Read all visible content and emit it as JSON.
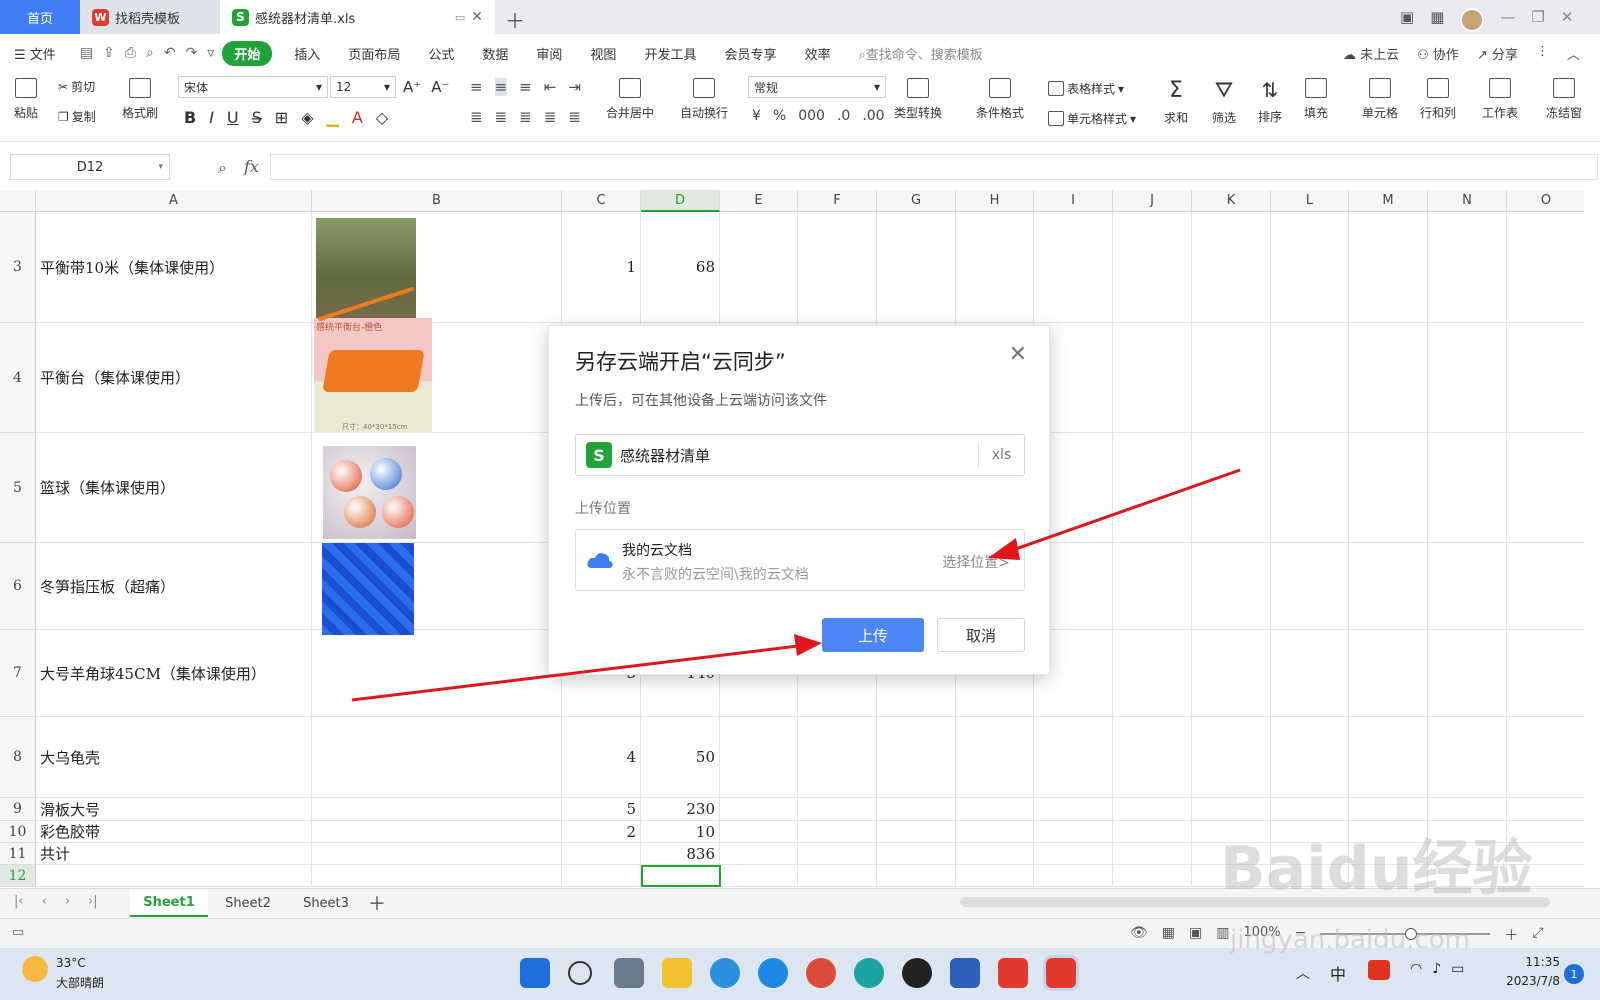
{
  "tabs": {
    "home": "首页",
    "template": "找稻壳模板",
    "file": "感统器材清单.xls"
  },
  "menu": {
    "file": "文件",
    "items": [
      "开始",
      "插入",
      "页面布局",
      "公式",
      "数据",
      "审阅",
      "视图",
      "开发工具",
      "会员专享",
      "效率"
    ],
    "search_placeholder": "查找命令、搜索模板",
    "cloud": "未上云",
    "collab": "协作",
    "share": "分享"
  },
  "ribbon": {
    "paste": "粘贴",
    "cut": "剪切",
    "copy": "复制",
    "format_painter": "格式刷",
    "font": "宋体",
    "size": "12",
    "merge": "合并居中",
    "wrap": "自动换行",
    "number_format": "常规",
    "type_convert": "类型转换",
    "cond_format": "条件格式",
    "table_style": "表格样式",
    "cell_style": "单元格样式",
    "sum": "求和",
    "filter": "筛选",
    "sort": "排序",
    "fill": "填充",
    "cell": "单元格",
    "row_col": "行和列",
    "sheet": "工作表",
    "freeze": "冻结窗"
  },
  "formula_bar": {
    "name_box": "D12",
    "fx": "fx",
    "value": ""
  },
  "columns": [
    "A",
    "B",
    "C",
    "D",
    "E",
    "F",
    "G",
    "H",
    "I",
    "J",
    "K",
    "L",
    "M",
    "N",
    "O"
  ],
  "rows": [
    {
      "num": "3",
      "a": "平衡带10米（集体课使用）",
      "c": "1",
      "d": "68"
    },
    {
      "num": "4",
      "a": "平衡台（集体课使用）",
      "c": "",
      "d": ""
    },
    {
      "num": "5",
      "a": "篮球（集体课使用）",
      "c": "",
      "d": ""
    },
    {
      "num": "6",
      "a": "冬笋指压板（超痛）",
      "c": "",
      "d": ""
    },
    {
      "num": "7",
      "a": "大号羊角球45CM（集体课使用）",
      "c": "3",
      "d": "140"
    },
    {
      "num": "8",
      "a": "大乌龟壳",
      "c": "4",
      "d": "50"
    },
    {
      "num": "9",
      "a": "滑板大号",
      "c": "5",
      "d": "230"
    },
    {
      "num": "10",
      "a": "彩色胶带",
      "c": "2",
      "d": "10"
    },
    {
      "num": "11",
      "a": "共计",
      "c": "",
      "d": "836"
    },
    {
      "num": "12",
      "a": "",
      "c": "",
      "d": ""
    }
  ],
  "pic_caption": {
    "balance_board": "感统平衡台-橙色",
    "board_size": "尺寸：40*30*15cm"
  },
  "sheets": [
    "Sheet1",
    "Sheet2",
    "Sheet3"
  ],
  "status": {
    "zoom": "100%"
  },
  "dialog": {
    "title": "另存云端开启“云同步”",
    "subtitle": "上传后，可在其他设备上云端访问该文件",
    "filename": "感统器材清单",
    "ext": "xls",
    "location_label": "上传位置",
    "location_name": "我的云文档",
    "location_path": "永不言败的云空间\\我的云文档",
    "choose": "选择位置>",
    "upload": "上传",
    "cancel": "取消"
  },
  "taskbar": {
    "temp": "33°C",
    "weather": "大部晴朗",
    "ime": "中",
    "time": "11:35",
    "date": "2023/7/8",
    "badge": "1"
  },
  "watermark": {
    "brand": "Baidu经验",
    "url": "jingyan.baidu.com"
  },
  "colors": {
    "green": "#21a33a",
    "blue": "#4a86f5",
    "arrow": "#e0161b"
  }
}
